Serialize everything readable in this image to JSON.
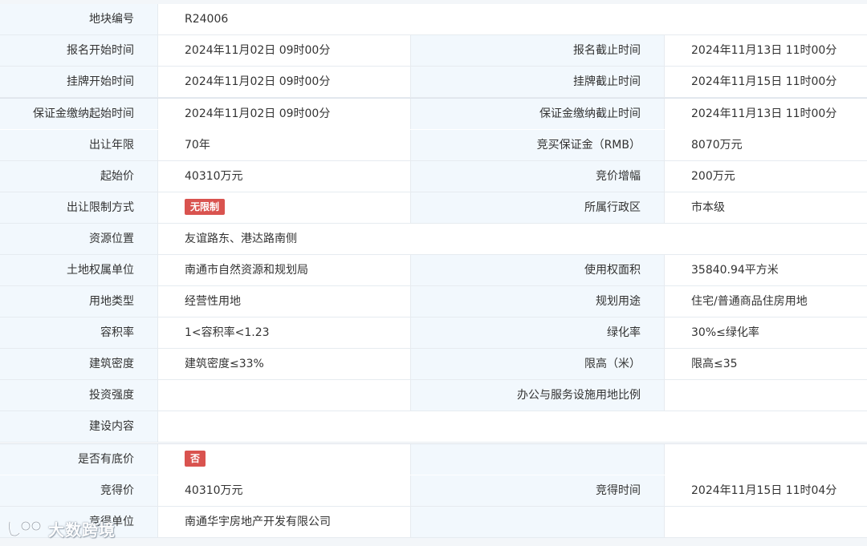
{
  "colors": {
    "label_bg": "#f2f8fd",
    "value_bg": "#ffffff",
    "border": "#e6ebf0",
    "badge_red": "#d9534f",
    "text": "#333333"
  },
  "rows": {
    "parcel_no": {
      "label": "地块编号",
      "value": "R24006"
    },
    "reg_start": {
      "label": "报名开始时间",
      "value": "2024年11月02日 09时00分"
    },
    "reg_end": {
      "label": "报名截止时间",
      "value": "2024年11月13日 11时00分"
    },
    "list_start": {
      "label": "挂牌开始时间",
      "value": "2024年11月02日 09时00分"
    },
    "list_end": {
      "label": "挂牌截止时间",
      "value": "2024年11月15日 11时00分"
    },
    "deposit_start": {
      "label": "保证金缴纳起始时间",
      "value": "2024年11月02日 09时00分"
    },
    "deposit_end": {
      "label": "保证金缴纳截止时间",
      "value": "2024年11月13日 11时00分"
    },
    "term": {
      "label": "出让年限",
      "value": "70年"
    },
    "deposit": {
      "label": "竞买保证金（RMB）",
      "value": "8070万元"
    },
    "start_price": {
      "label": "起始价",
      "value": "40310万元"
    },
    "increment": {
      "label": "竞价增幅",
      "value": "200万元"
    },
    "restriction": {
      "label": "出让限制方式",
      "badge": "无限制"
    },
    "district": {
      "label": "所属行政区",
      "value": "市本级"
    },
    "location": {
      "label": "资源位置",
      "value": "友谊路东、港达路南侧"
    },
    "owner": {
      "label": "土地权属单位",
      "value": "南通市自然资源和规划局"
    },
    "area": {
      "label": "使用权面积",
      "value": "35840.94平方米"
    },
    "land_type": {
      "label": "用地类型",
      "value": "经营性用地"
    },
    "planned_use": {
      "label": "规划用途",
      "value": "住宅/普通商品住房用地"
    },
    "far": {
      "label": "容积率",
      "value": "1<容积率<1.23"
    },
    "green": {
      "label": "绿化率",
      "value": "30%≤绿化率"
    },
    "density": {
      "label": "建筑密度",
      "value": "建筑密度≤33%"
    },
    "height": {
      "label": "限高（米）",
      "value": "限高≤35"
    },
    "investment": {
      "label": "投资强度",
      "value": ""
    },
    "office_ratio": {
      "label": "办公与服务设施用地比例",
      "value": ""
    },
    "construction": {
      "label": "建设内容",
      "value": ""
    },
    "reserve": {
      "label": "是否有底价",
      "badge": "否"
    },
    "win_price": {
      "label": "竞得价",
      "value": "40310万元"
    },
    "win_time": {
      "label": "竞得时间",
      "value": "2024年11月15日 11时04分"
    },
    "winner": {
      "label": "竞得单位",
      "value": "南通华宇房地产开发有限公司"
    }
  },
  "watermark": {
    "text": "大数跨境",
    "icon": "brand-logo-icon"
  }
}
